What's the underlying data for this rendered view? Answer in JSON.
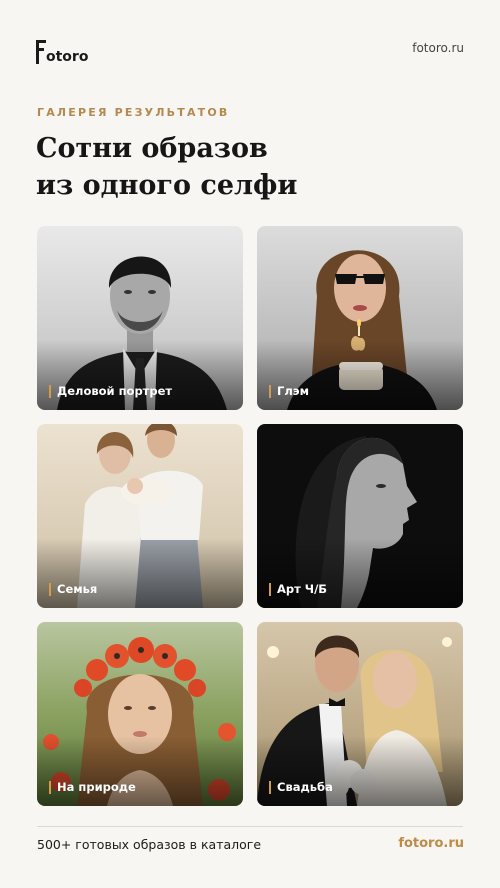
{
  "header": {
    "logo_text": "otoro",
    "site_link": "fotoro.ru"
  },
  "eyebrow": "ГАЛЕРЕЯ РЕЗУЛЬТАТОВ",
  "title": "Сотни образов\nиз одного селфи",
  "gallery": [
    {
      "label": "Деловой портрет"
    },
    {
      "label": "Глэм"
    },
    {
      "label": "Семья"
    },
    {
      "label": "Арт Ч/Б"
    },
    {
      "label": "На природе"
    },
    {
      "label": "Свадьба"
    }
  ],
  "footer": {
    "caption": "500+ готовых образов в каталоге",
    "link": "fotoro.ru"
  },
  "colors": {
    "background": "#f7f6f3",
    "accent": "#c08a47",
    "eyebrow": "#b5894f"
  }
}
